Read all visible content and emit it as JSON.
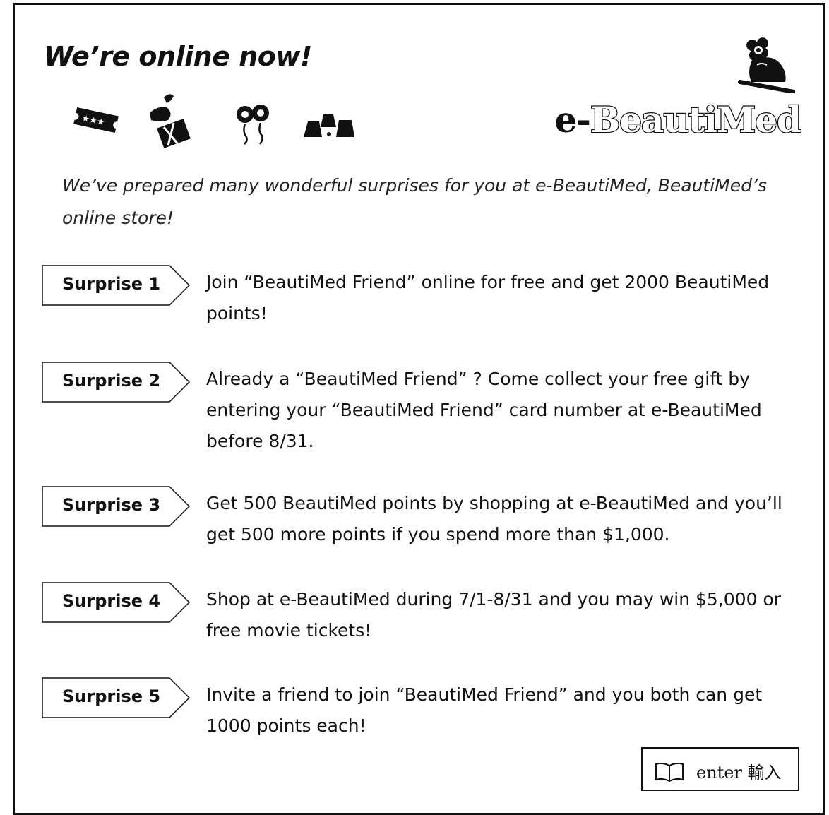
{
  "headline": "We’re online now!",
  "icons": [
    "ticket-icon",
    "gift-box-icon",
    "flower-balloons-icon",
    "blocks-icon"
  ],
  "brand": {
    "prefix": "e-",
    "name": "BeautiMed",
    "logo_icon": "flower-figure-icon"
  },
  "intro": "We’ve prepared many wonderful surprises for you at e-BeautiMed, BeautiMed’s online store!",
  "surprises": [
    {
      "label": "Surprise 1",
      "text": "Join “BeautiMed Friend” online for free and get 2000 BeautiMed points!"
    },
    {
      "label": "Surprise 2",
      "text": "Already a “BeautiMed Friend” ?  Come collect your free gift by entering your “BeautiMed Friend” card number at e-BeautiMed before 8/31."
    },
    {
      "label": "Surprise 3",
      "text": "Get 500 BeautiMed points by shopping at e-BeautiMed and you’ll get 500 more points if you spend more than $1,000."
    },
    {
      "label": "Surprise 4",
      "text": "Shop at e-BeautiMed during 7/1-8/31 and you may win $5,000 or free movie tickets!"
    },
    {
      "label": "Surprise 5",
      "text": "Invite a friend to join “BeautiMed Friend” and you both can get 1000 points each!"
    }
  ],
  "enter_button": {
    "label": "enter 輸入",
    "icon": "book-icon"
  }
}
